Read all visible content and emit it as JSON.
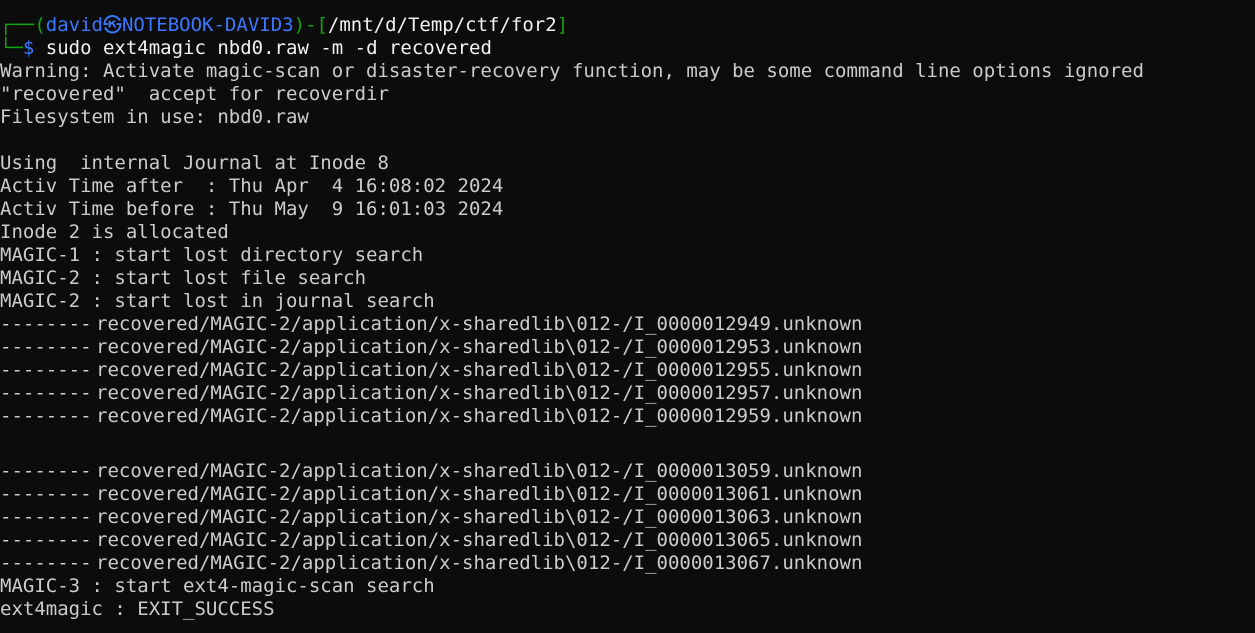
{
  "prompt": {
    "corner_top": "┌──(",
    "user": "david",
    "at_symbol": "㉿",
    "host": "NOTEBOOK-DAVID3",
    "mid": ")-[",
    "path": "/mnt/d/Temp/ctf/for2",
    "close": "]",
    "corner_bottom": "└─",
    "dollar": "$",
    "command": " sudo ext4magic nbd0.raw -m -d recovered"
  },
  "output_head": [
    "Warning: Activate magic-scan or disaster-recovery function, may be some command line options ignored",
    "\"recovered\"  accept for recoverdir",
    "Filesystem in use: nbd0.raw",
    "",
    "Using  internal Journal at Inode 8",
    "Activ Time after  : Thu Apr  4 16:08:02 2024",
    "Activ Time before : Thu May  9 16:01:03 2024",
    "Inode 2 is allocated",
    "MAGIC-1 : start lost directory search",
    "MAGIC-2 : start lost file search",
    "MAGIC-2 : start lost in journal search"
  ],
  "recovered_group_1": [
    {
      "marker": "--------",
      "path": "recovered/MAGIC-2/application/x-sharedlib\\012-/I_0000012949.unknown"
    },
    {
      "marker": "--------",
      "path": "recovered/MAGIC-2/application/x-sharedlib\\012-/I_0000012953.unknown"
    },
    {
      "marker": "--------",
      "path": "recovered/MAGIC-2/application/x-sharedlib\\012-/I_0000012955.unknown"
    },
    {
      "marker": "--------",
      "path": "recovered/MAGIC-2/application/x-sharedlib\\012-/I_0000012957.unknown"
    },
    {
      "marker": "--------",
      "path": "recovered/MAGIC-2/application/x-sharedlib\\012-/I_0000012959.unknown"
    }
  ],
  "recovered_group_2": [
    {
      "marker": "--------",
      "path": "recovered/MAGIC-2/application/x-sharedlib\\012-/I_0000013059.unknown"
    },
    {
      "marker": "--------",
      "path": "recovered/MAGIC-2/application/x-sharedlib\\012-/I_0000013061.unknown"
    },
    {
      "marker": "--------",
      "path": "recovered/MAGIC-2/application/x-sharedlib\\012-/I_0000013063.unknown"
    },
    {
      "marker": "--------",
      "path": "recovered/MAGIC-2/application/x-sharedlib\\012-/I_0000013065.unknown"
    },
    {
      "marker": "--------",
      "path": "recovered/MAGIC-2/application/x-sharedlib\\012-/I_0000013067.unknown"
    }
  ],
  "output_tail": [
    "MAGIC-3 : start ext4-magic-scan search",
    "ext4magic : EXIT_SUCCESS"
  ],
  "colors": {
    "background": "#0c0c0c",
    "text": "#cccccc",
    "prompt_green": "#13a10e",
    "prompt_blue": "#3b78ff",
    "command_white": "#f2f2f2"
  }
}
